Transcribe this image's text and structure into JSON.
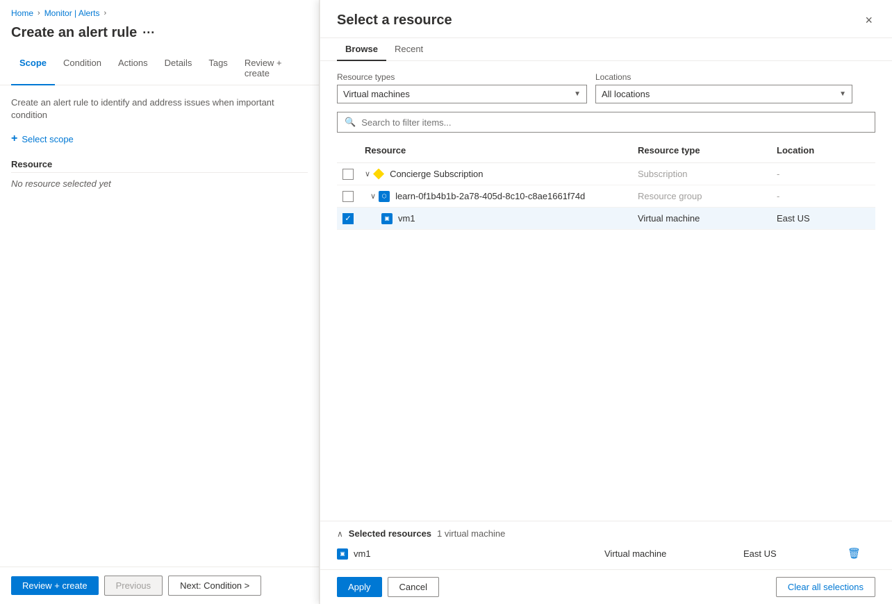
{
  "breadcrumb": {
    "home": "Home",
    "monitor": "Monitor | Alerts",
    "sep1": "›",
    "sep2": "›"
  },
  "page": {
    "title": "Create an alert rule",
    "ellipsis": "···"
  },
  "wizard": {
    "tabs": [
      {
        "id": "scope",
        "label": "Scope",
        "active": true
      },
      {
        "id": "condition",
        "label": "Condition"
      },
      {
        "id": "actions",
        "label": "Actions"
      },
      {
        "id": "details",
        "label": "Details"
      },
      {
        "id": "tags",
        "label": "Tags"
      },
      {
        "id": "review",
        "label": "Review + create"
      }
    ],
    "description": "Create an alert rule to identify and address issues when important condition",
    "select_scope_label": "Select scope",
    "resource_label": "Resource",
    "no_resource": "No resource selected yet"
  },
  "footer": {
    "review_create": "Review + create",
    "previous": "Previous",
    "next": "Next: Condition >"
  },
  "panel": {
    "title": "Select a resource",
    "close": "×",
    "tabs": [
      {
        "id": "browse",
        "label": "Browse",
        "active": true
      },
      {
        "id": "recent",
        "label": "Recent"
      }
    ],
    "filters": {
      "resource_types_label": "Resource types",
      "resource_types_value": "Virtual machines",
      "locations_label": "Locations",
      "locations_value": "All locations"
    },
    "search_placeholder": "Search to filter items...",
    "table": {
      "headers": [
        "",
        "Resource",
        "Resource type",
        "Location"
      ],
      "rows": [
        {
          "id": "row-subscription",
          "indent": 0,
          "checkbox": false,
          "expandable": true,
          "expanded": true,
          "icon": "subscription",
          "name": "Concierge Subscription",
          "resource_type": "Subscription",
          "location": "-"
        },
        {
          "id": "row-resource-group",
          "indent": 1,
          "checkbox": false,
          "expandable": true,
          "expanded": true,
          "icon": "resource-group",
          "name": "learn-0f1b4b1b-2a78-405d-8c10-c8ae1661f74d",
          "resource_type": "Resource group",
          "location": "-"
        },
        {
          "id": "row-vm1",
          "indent": 2,
          "checkbox": true,
          "checked": true,
          "expandable": false,
          "icon": "vm",
          "name": "vm1",
          "resource_type": "Virtual machine",
          "location": "East US",
          "selected": true
        }
      ]
    },
    "selected_resources": {
      "collapse_icon": "∧",
      "title": "Selected resources",
      "count": "1 virtual machine",
      "items": [
        {
          "icon": "vm",
          "name": "vm1",
          "resource_type": "Virtual machine",
          "location": "East US"
        }
      ]
    },
    "buttons": {
      "apply": "Apply",
      "cancel": "Cancel",
      "clear_all": "Clear all selections"
    }
  }
}
